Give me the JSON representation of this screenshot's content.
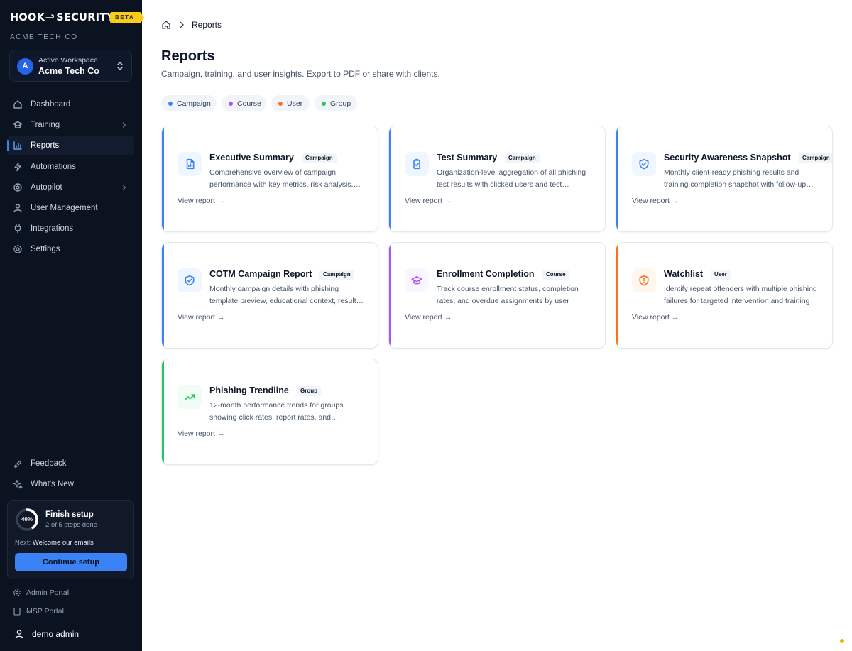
{
  "brand": {
    "logo_left": "HOOK",
    "logo_right": "SECURITY",
    "beta": "BETA",
    "org": "ACME TECH CO"
  },
  "workspace": {
    "label": "Active Workspace",
    "name": "Acme Tech Co",
    "initial": "A"
  },
  "nav": [
    {
      "label": "Dashboard",
      "icon": "home-icon",
      "chevron": false,
      "active": false
    },
    {
      "label": "Training",
      "icon": "graduation-cap-icon",
      "chevron": true,
      "active": false
    },
    {
      "label": "Reports",
      "icon": "bar-chart-icon",
      "chevron": false,
      "active": true
    },
    {
      "label": "Automations",
      "icon": "zap-icon",
      "chevron": false,
      "active": false
    },
    {
      "label": "Autopilot",
      "icon": "target-icon",
      "chevron": true,
      "active": false
    },
    {
      "label": "User Management",
      "icon": "user-icon",
      "chevron": false,
      "active": false
    },
    {
      "label": "Integrations",
      "icon": "plug-icon",
      "chevron": false,
      "active": false
    },
    {
      "label": "Settings",
      "icon": "gear-icon",
      "chevron": false,
      "active": false
    }
  ],
  "footer_nav": [
    {
      "label": "Feedback",
      "icon": "pencil-icon"
    },
    {
      "label": "What's New",
      "icon": "sparkles-icon"
    }
  ],
  "setup": {
    "progress_label": "40%",
    "progress": 0.4,
    "title": "Finish setup",
    "steps": "2 of 5 steps done",
    "next_prefix": "Next:",
    "next_value": "Welcome our emails",
    "button": "Continue setup"
  },
  "portals": [
    {
      "label": "Admin Portal",
      "icon": "gear-icon"
    },
    {
      "label": "MSP Portal",
      "icon": "building-icon"
    }
  ],
  "user": {
    "name": "demo admin"
  },
  "breadcrumb": {
    "current": "Reports"
  },
  "page": {
    "title": "Reports",
    "subtitle": "Campaign, training, and user insights. Export to PDF or share with clients."
  },
  "filters": [
    {
      "label": "Campaign",
      "color": "#3b82f6"
    },
    {
      "label": "Course",
      "color": "#a855f7"
    },
    {
      "label": "User",
      "color": "#f97316"
    },
    {
      "label": "Group",
      "color": "#22c55e"
    }
  ],
  "reports": [
    {
      "title": "Executive Summary",
      "badge": "Campaign",
      "desc": "Comprehensive overview of campaign performance with key metrics, risk analysis, and recommendations",
      "link": "View report →",
      "accent": "#3b82f6",
      "icon": "file-chart-icon"
    },
    {
      "title": "Test Summary",
      "badge": "Campaign",
      "desc": "Organization-level aggregation of all phishing test results with clicked users and test statistics",
      "link": "View report →",
      "accent": "#3b82f6",
      "icon": "clipboard-check-icon"
    },
    {
      "title": "Security Awareness Snapshot",
      "badge": "Campaign",
      "desc": "Monthly client-ready phishing results and training completion snapshot with follow-up actions",
      "link": "View report →",
      "accent": "#3b82f6",
      "icon": "shield-check-icon"
    },
    {
      "title": "COTM Campaign Report",
      "badge": "Campaign",
      "desc": "Monthly campaign details with phishing template preview, educational context, results and more",
      "link": "View report →",
      "accent": "#3b82f6",
      "icon": "shield-check-icon"
    },
    {
      "title": "Enrollment Completion",
      "badge": "Course",
      "desc": "Track course enrollment status, completion rates, and overdue assignments by user",
      "link": "View report →",
      "accent": "#a855f7",
      "icon": "graduation-cap-icon"
    },
    {
      "title": "Watchlist",
      "badge": "User",
      "desc": "Identify repeat offenders with multiple phishing failures for targeted intervention and training",
      "link": "View report →",
      "accent": "#f97316",
      "icon": "shield-alert-icon"
    },
    {
      "title": "Phishing Trendline",
      "badge": "Group",
      "desc": "12-month performance trends for groups showing click rates, report rates, and improvement over time",
      "link": "View report →",
      "accent": "#22c55e",
      "icon": "trending-up-icon"
    }
  ]
}
